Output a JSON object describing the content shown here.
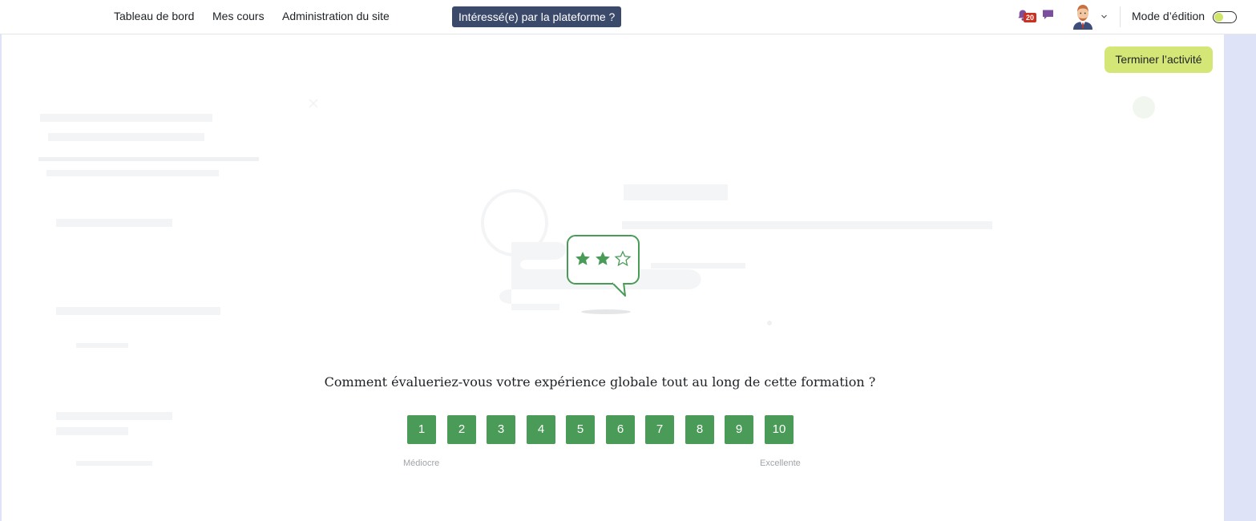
{
  "navbar": {
    "links": [
      "Tableau de bord",
      "Mes cours",
      "Administration du site"
    ],
    "promo_button": "Intéressé(e) par la plateforme ?",
    "notifications_count": "20",
    "edit_mode_label": "Mode d’édition",
    "edit_mode_on": false,
    "icons": [
      "bell-icon",
      "chat-icon",
      "avatar",
      "chevron-down-icon"
    ]
  },
  "activity": {
    "finish_button": "Terminer l’activité"
  },
  "rating": {
    "illustration_icon": "rating-stars-speech-bubble",
    "question": "Comment évalueriez-vous votre expérience globale tout au long de cette formation ?",
    "options": [
      "1",
      "2",
      "3",
      "4",
      "5",
      "6",
      "7",
      "8",
      "9",
      "10"
    ],
    "low_label": "Médiocre",
    "high_label": "Excellente"
  },
  "colors": {
    "navbar_button_bg": "#3b4a6b",
    "finish_button_bg": "#d4e776",
    "rating_green": "#4b9b58",
    "side_panel": "#dfe3f7",
    "badge_red": "#ca3120"
  }
}
